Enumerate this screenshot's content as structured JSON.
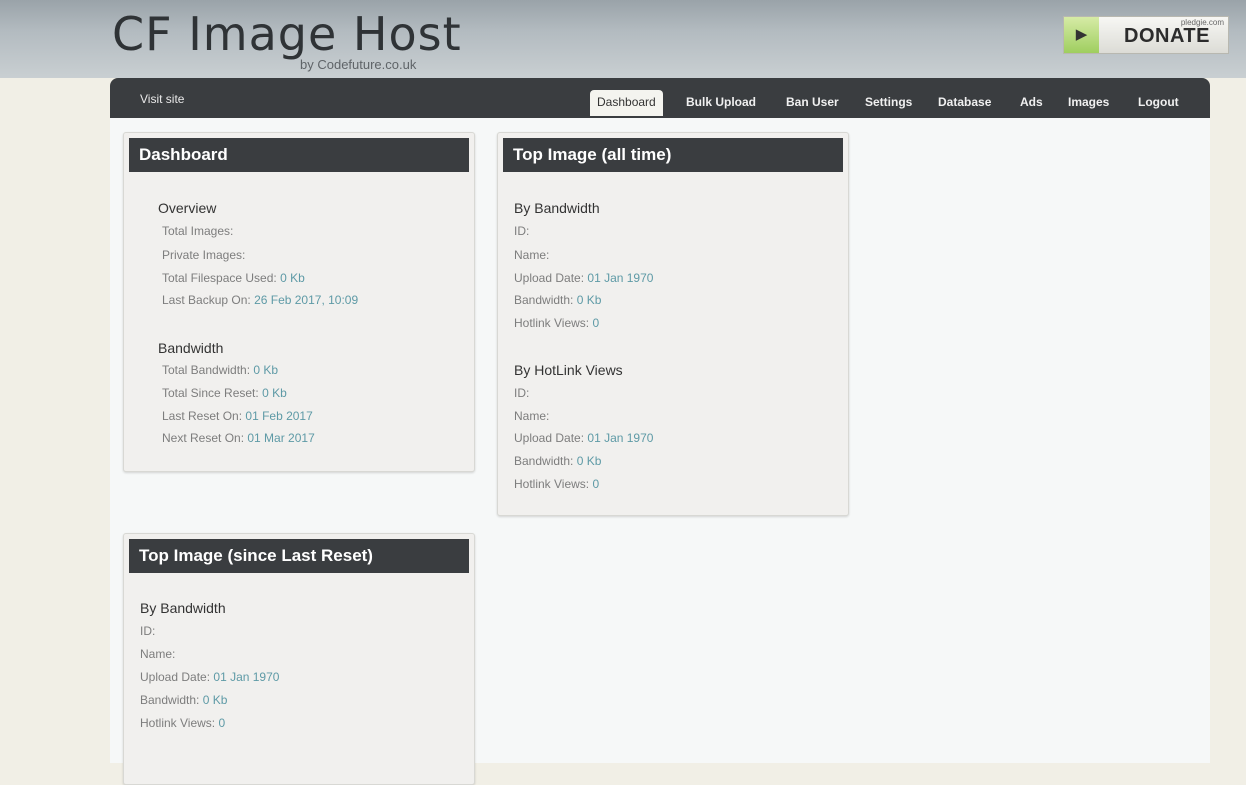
{
  "header": {
    "title": "CF Image Host",
    "subtitle": "by Codefuture.co.uk",
    "donate": {
      "label": "DONATE",
      "brand": "pledgie.com",
      "icon": "play-icon",
      "accent": "#9fce5f"
    }
  },
  "nav": {
    "visit_site": "Visit site",
    "tabs": [
      "Dashboard",
      "Bulk Upload",
      "Ban User",
      "Settings",
      "Database",
      "Ads",
      "Images",
      "Logout"
    ],
    "active": "Dashboard"
  },
  "dashboard": {
    "title": "Dashboard",
    "overview": {
      "heading": "Overview",
      "total_images": {
        "label": "Total Images:",
        "value": ""
      },
      "private_images": {
        "label": "Private Images:",
        "value": ""
      },
      "filespace": {
        "label": "Total Filespace Used:",
        "value": "0 Kb"
      },
      "last_backup": {
        "label": "Last Backup On:",
        "value": "26 Feb 2017, 10:09"
      }
    },
    "bandwidth": {
      "heading": "Bandwidth",
      "total": {
        "label": "Total Bandwidth:",
        "value": "0 Kb"
      },
      "since_reset": {
        "label": "Total Since Reset:",
        "value": "0 Kb"
      },
      "last_reset": {
        "label": "Last Reset On:",
        "value": "01 Feb 2017"
      },
      "next_reset": {
        "label": "Next Reset On:",
        "value": "01 Mar 2017"
      }
    }
  },
  "top_all_time": {
    "title": "Top Image (all time)",
    "by_bandwidth": {
      "heading": "By Bandwidth",
      "id": {
        "label": "ID:",
        "value": ""
      },
      "name": {
        "label": "Name:",
        "value": ""
      },
      "upload_date": {
        "label": "Upload Date:",
        "value": "01 Jan 1970"
      },
      "bandwidth": {
        "label": "Bandwidth:",
        "value": "0 Kb"
      },
      "hotlink_views": {
        "label": "Hotlink Views:",
        "value": "0"
      }
    },
    "by_hotlink": {
      "heading": "By HotLink Views",
      "id": {
        "label": "ID:",
        "value": ""
      },
      "name": {
        "label": "Name:",
        "value": ""
      },
      "upload_date": {
        "label": "Upload Date:",
        "value": "01 Jan 1970"
      },
      "bandwidth": {
        "label": "Bandwidth:",
        "value": "0 Kb"
      },
      "hotlink_views": {
        "label": "Hotlink Views:",
        "value": "0"
      }
    }
  },
  "top_since_reset": {
    "title": "Top Image (since Last Reset)",
    "by_bandwidth": {
      "heading": "By Bandwidth",
      "id": {
        "label": "ID:",
        "value": ""
      },
      "name": {
        "label": "Name:",
        "value": ""
      },
      "upload_date": {
        "label": "Upload Date:",
        "value": "01 Jan 1970"
      },
      "bandwidth": {
        "label": "Bandwidth:",
        "value": "0 Kb"
      },
      "hotlink_views": {
        "label": "Hotlink Views:",
        "value": "0"
      }
    }
  }
}
